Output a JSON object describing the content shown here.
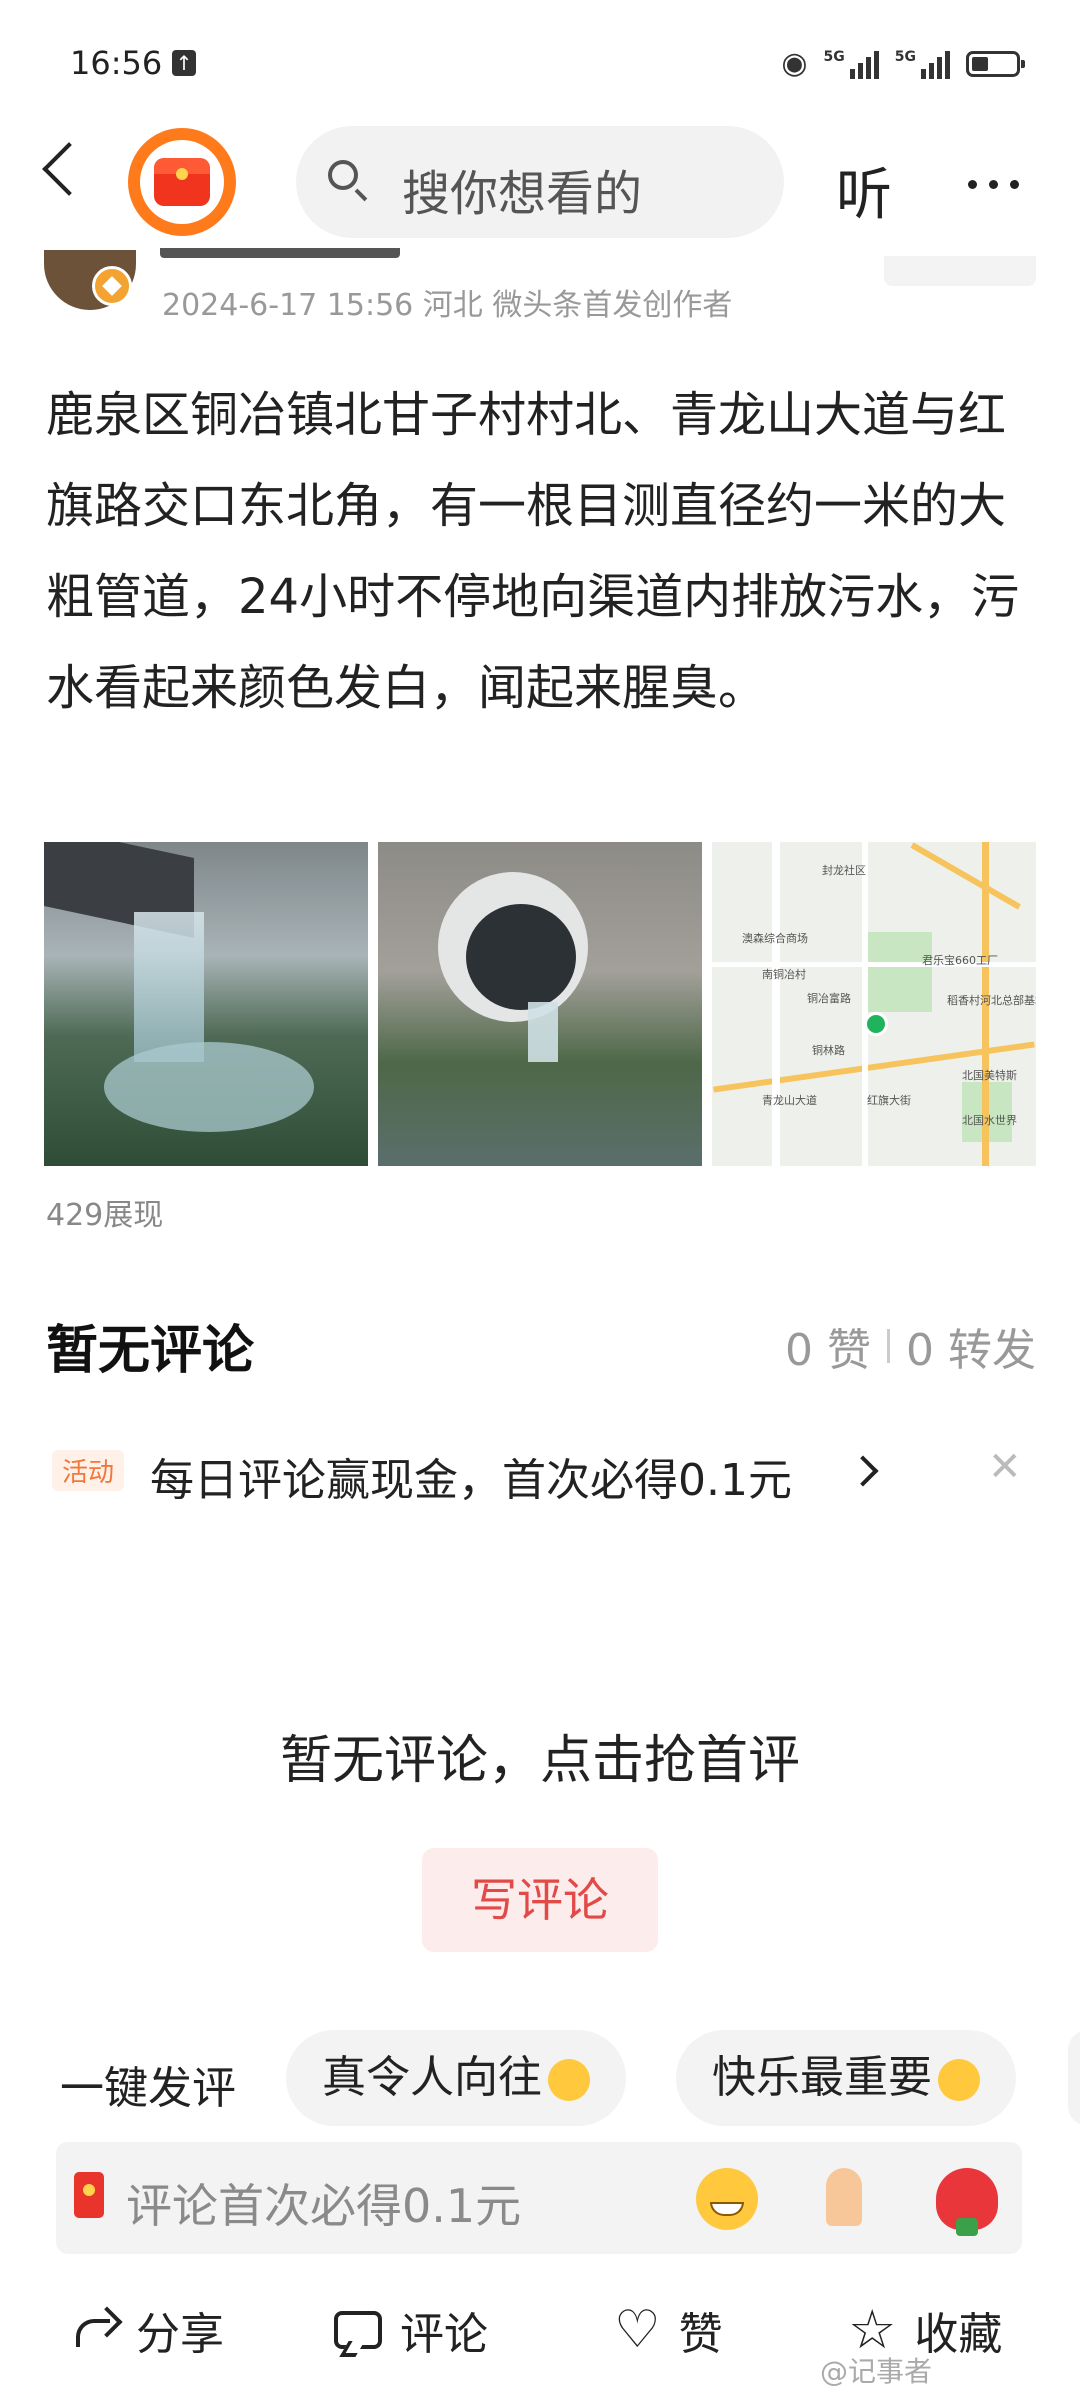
{
  "status_bar": {
    "time": "16:56",
    "network_1": "5G",
    "network_2": "5G"
  },
  "top_nav": {
    "search_placeholder": "搜你想看的",
    "listen_label": "听"
  },
  "post": {
    "meta": "2024-6-17 15:56 河北 微头条首发创作者",
    "content": "鹿泉区铜冶镇北甘子村村北、青龙山大道与红旗路交口东北角，有一根目测直径约一米的大粗管道，24小时不停地向渠道内排放污水，污水看起来颜色发白，闻起来腥臭。",
    "views": "429展现",
    "map_labels": {
      "community": "封龙社区",
      "village": "南铜冶村",
      "road1": "青龙山大道",
      "road2": "红旗大街",
      "poi1": "君乐宝660工厂",
      "poi2": "稻香村河北总部基地",
      "poi3": "北国美特斯",
      "poi4": "北国水世界",
      "poi5": "澳森综合商场",
      "poi6": "铜冶富路",
      "poi7": "铜林路"
    }
  },
  "comments": {
    "title": "暂无评论",
    "likes": "0 赞",
    "shares": "0 转发",
    "promo_tag": "活动",
    "promo_text": "每日评论赢现金，首次必得0.1元",
    "empty_text": "暂无评论，点击抢首评",
    "write_button": "写评论"
  },
  "quick_reply": {
    "label": "一键发评",
    "chips": [
      "真令人向往",
      "快乐最重要"
    ]
  },
  "comment_input": {
    "placeholder": "评论首次必得0.1元"
  },
  "bottom_bar": {
    "share": "分享",
    "comment": "评论",
    "like": "赞",
    "favorite": "收藏"
  },
  "watermark": "@记事者"
}
